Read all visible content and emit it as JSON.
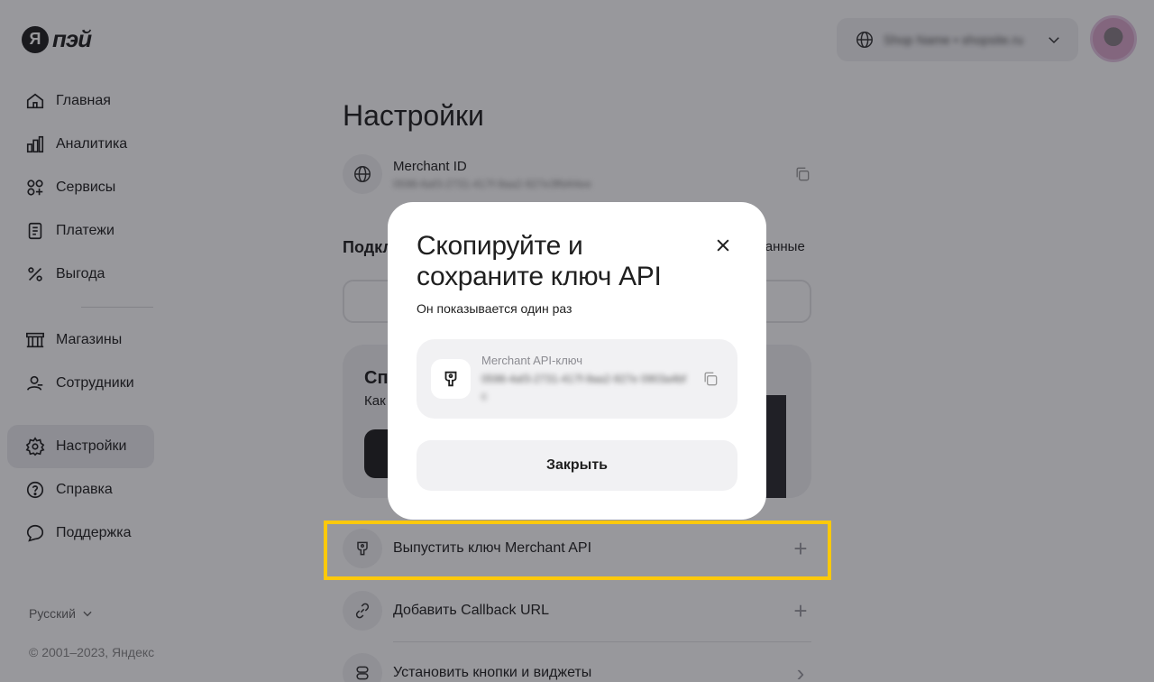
{
  "header": {
    "logo_letter": "Я",
    "logo_text": "пэй",
    "shop_selector": "Shop Name • shopsite.ru"
  },
  "sidebar": {
    "items": [
      {
        "label": "Главная",
        "icon": "home-icon"
      },
      {
        "label": "Аналитика",
        "icon": "analytics-icon"
      },
      {
        "label": "Сервисы",
        "icon": "services-icon"
      },
      {
        "label": "Платежи",
        "icon": "payments-icon"
      },
      {
        "label": "Выгода",
        "icon": "percent-icon"
      },
      {
        "label": "Магазины",
        "icon": "store-icon"
      },
      {
        "label": "Сотрудники",
        "icon": "employees-icon"
      },
      {
        "label": "Настройки",
        "icon": "gear-icon",
        "active": true
      },
      {
        "label": "Справка",
        "icon": "help-icon"
      },
      {
        "label": "Поддержка",
        "icon": "chat-icon"
      }
    ],
    "language": "Русский",
    "copyright": "© 2001–2023, Яндекс"
  },
  "main": {
    "title": "Настройки",
    "merchant_id_label": "Merchant ID",
    "merchant_id_value": "0598-6af3-2731-417f-9aa2-927e3ffd44ee",
    "section_title": "Подкл",
    "section_right": "данные",
    "promo_title": "Сп",
    "promo_sub": "Как",
    "actions": [
      {
        "label": "Выпустить ключ Merchant API",
        "icon": "key-icon",
        "trail": "+"
      },
      {
        "label": "Добавить Callback URL",
        "icon": "link-icon",
        "trail": "+"
      },
      {
        "label": "Установить кнопки и виджеты",
        "icon": "widget-icon",
        "trail": "›"
      }
    ]
  },
  "modal": {
    "title": "Скопируйте и сохраните ключ API",
    "subtitle": "Он показывается один раз",
    "key_label": "Merchant API-ключ",
    "key_value": "0598-4af3-2731-417f-9aa2-927e 0903a4bfc",
    "close_button": "Закрыть"
  },
  "colors": {
    "highlight": "#fcc90c",
    "overlay": "rgba(20,20,30,0.44)"
  }
}
